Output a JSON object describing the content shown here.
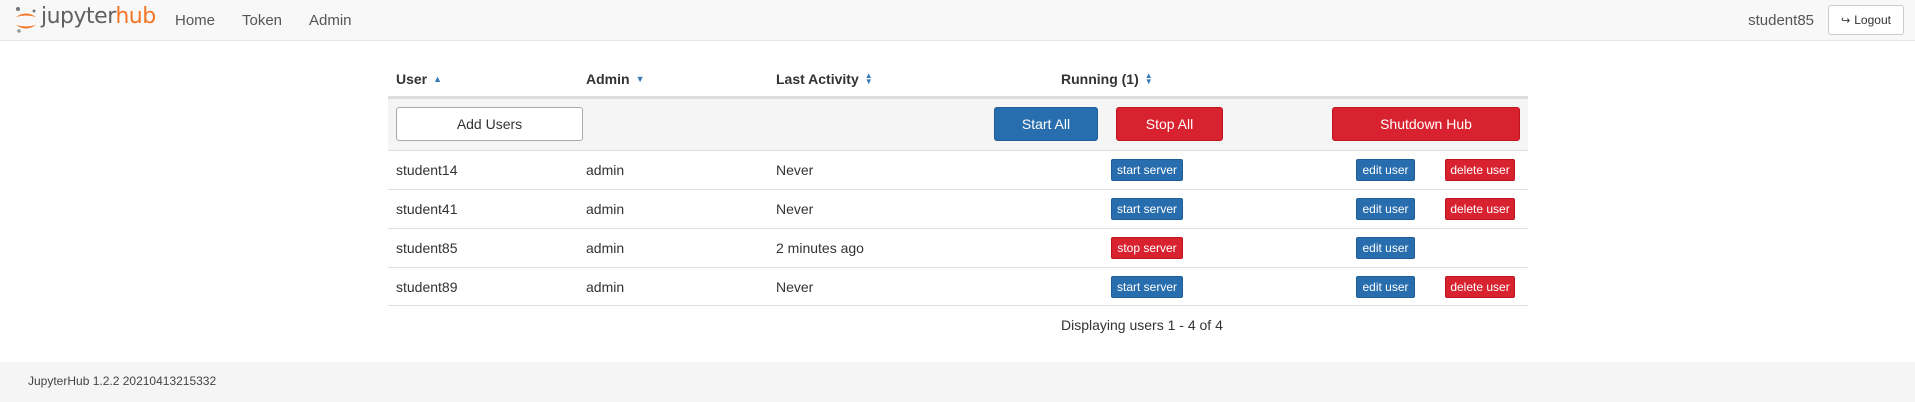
{
  "brand": {
    "part1": "jupyter",
    "part2": "hub"
  },
  "nav": {
    "links": [
      {
        "label": "Home"
      },
      {
        "label": "Token"
      },
      {
        "label": "Admin"
      }
    ],
    "username": "student85",
    "logout_label": "Logout"
  },
  "table": {
    "headers": {
      "user": "User",
      "admin": "Admin",
      "last_activity": "Last Activity",
      "running": "Running (1)"
    },
    "actions": {
      "add_users": "Add Users",
      "start_all": "Start All",
      "stop_all": "Stop All",
      "shutdown_hub": "Shutdown Hub"
    },
    "rows": [
      {
        "user": "student14",
        "admin": "admin",
        "last_activity": "Never",
        "server_action": "start server",
        "edit": "edit user",
        "delete": "delete user"
      },
      {
        "user": "student41",
        "admin": "admin",
        "last_activity": "Never",
        "server_action": "start server",
        "edit": "edit user",
        "delete": "delete user"
      },
      {
        "user": "student85",
        "admin": "admin",
        "last_activity": "2 minutes ago",
        "server_action": "stop server",
        "edit": "edit user"
      },
      {
        "user": "student89",
        "admin": "admin",
        "last_activity": "Never",
        "server_action": "start server",
        "edit": "edit user",
        "delete": "delete user"
      }
    ],
    "paging": "Displaying users 1 - 4 of 4"
  },
  "footer": {
    "version": "JupyterHub 1.2.2 20210413215332"
  },
  "colors": {
    "primary": "#286dad",
    "danger": "#d9222f",
    "brand_orange": "#f37626"
  }
}
